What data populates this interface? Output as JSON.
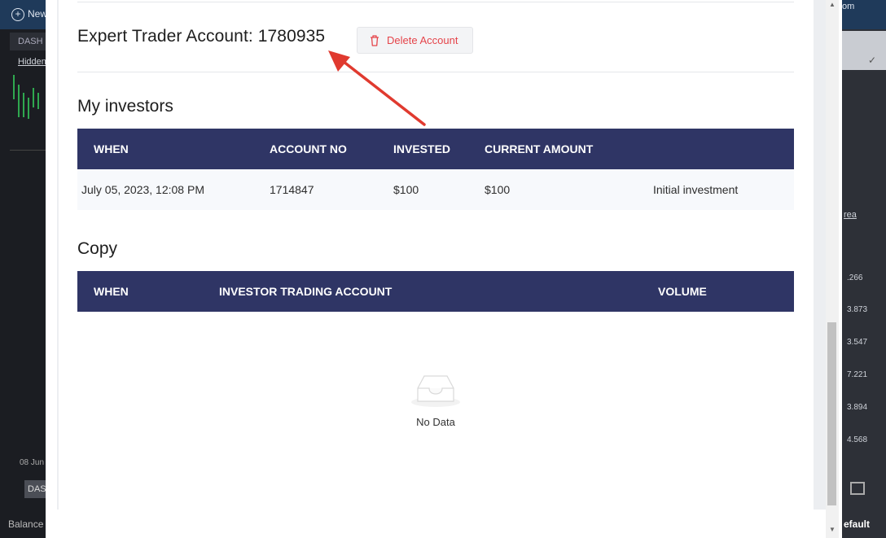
{
  "background_app": {
    "new_button_label": "New",
    "tab_label": "DASH",
    "hidden_link": "Hidden",
    "date_text": "08 Jun",
    "das_button": "DAS",
    "balance_label": "Balance",
    "right_top_text": "om",
    "right_link": "rea",
    "right_numbers": [
      ".266",
      "3.873",
      "3.547",
      "7.221",
      "3.894",
      "4.568"
    ],
    "default_label": "efault"
  },
  "account": {
    "title": "Expert Trader Account: 1780935",
    "delete_label": "Delete Account"
  },
  "investors": {
    "title": "My investors",
    "columns": [
      "WHEN",
      "ACCOUNT NO",
      "INVESTED",
      "CURRENT AMOUNT"
    ],
    "rows": [
      {
        "when": "July 05, 2023, 12:08 PM",
        "account_no": "1714847",
        "invested": "$100",
        "current_amount": "$100",
        "note": "Initial investment"
      }
    ]
  },
  "copy": {
    "title": "Copy",
    "columns": [
      "WHEN",
      "INVESTOR TRADING ACCOUNT",
      "VOLUME"
    ],
    "empty_text": "No Data"
  },
  "colors": {
    "table_header": "#2f3565",
    "delete_red": "#e5444a",
    "annotation_arrow": "#e03a2f"
  },
  "icons": {
    "delete": "trash-icon",
    "empty": "empty-inbox-icon",
    "annotation": "annotation-arrow"
  }
}
